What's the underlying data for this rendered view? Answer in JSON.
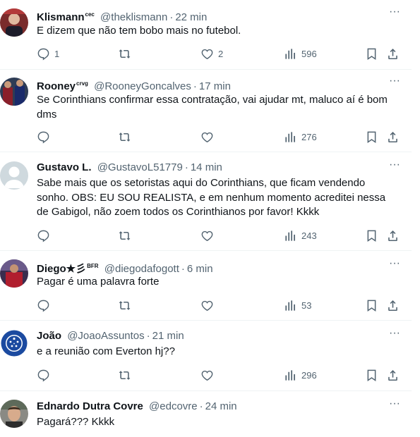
{
  "tweets": [
    {
      "name": "Klismann",
      "badge": "cec",
      "handle": "@theklismann",
      "time": "22 min",
      "text": "E dizem que não tem bobo mais no futebol.",
      "replies": "1",
      "retweets": "",
      "likes": "2",
      "views": "596",
      "avatar_color": "#7a2b2b"
    },
    {
      "name": "Rooney",
      "badge": "crvg",
      "handle": "@RooneyGoncalves",
      "time": "17 min",
      "text": "Se Corinthians confirmar essa contratação, vai ajudar mt, maluco aí é bom\ndms",
      "replies": "",
      "retweets": "",
      "likes": "",
      "views": "276",
      "avatar_color": "#2e3c55"
    },
    {
      "name": "Gustavo L.",
      "badge": "",
      "handle": "@GustavoL51779",
      "time": "14 min",
      "text": "Sabe mais que os setoristas aqui do Corinthians, que ficam vendendo\nsonho. OBS: EU SOU REALISTA, e em nenhum momento acreditei nessa\nde Gabigol, não zoem todos os Corinthianos por favor! Kkkk",
      "replies": "",
      "retweets": "",
      "likes": "",
      "views": "243",
      "avatar_color": "#cfd9de"
    },
    {
      "name": "Diego★彡",
      "badge": "BFR",
      "handle": "@diegodafogott",
      "time": "6 min",
      "text": "Pagar é uma palavra forte",
      "replies": "",
      "retweets": "",
      "likes": "",
      "views": "53",
      "avatar_color": "#3a2d4e"
    },
    {
      "name": "João",
      "badge": "",
      "handle": "@JoaoAssuntos",
      "time": "21 min",
      "text": "e a reunião com Everton hj??",
      "replies": "",
      "retweets": "",
      "likes": "",
      "views": "296",
      "avatar_color": "#1b4aa0"
    },
    {
      "name": "Ednardo Dutra Covre",
      "badge": "",
      "handle": "@edcovre",
      "time": "24 min",
      "text": "Pagará??? Kkkk",
      "avatar_color": "#8a8a84"
    }
  ],
  "icons": {
    "reply": "reply-icon",
    "retweet": "retweet-icon",
    "like": "like-icon",
    "views": "views-icon",
    "bookmark": "bookmark-icon",
    "share": "share-icon",
    "more": "more-icon"
  }
}
